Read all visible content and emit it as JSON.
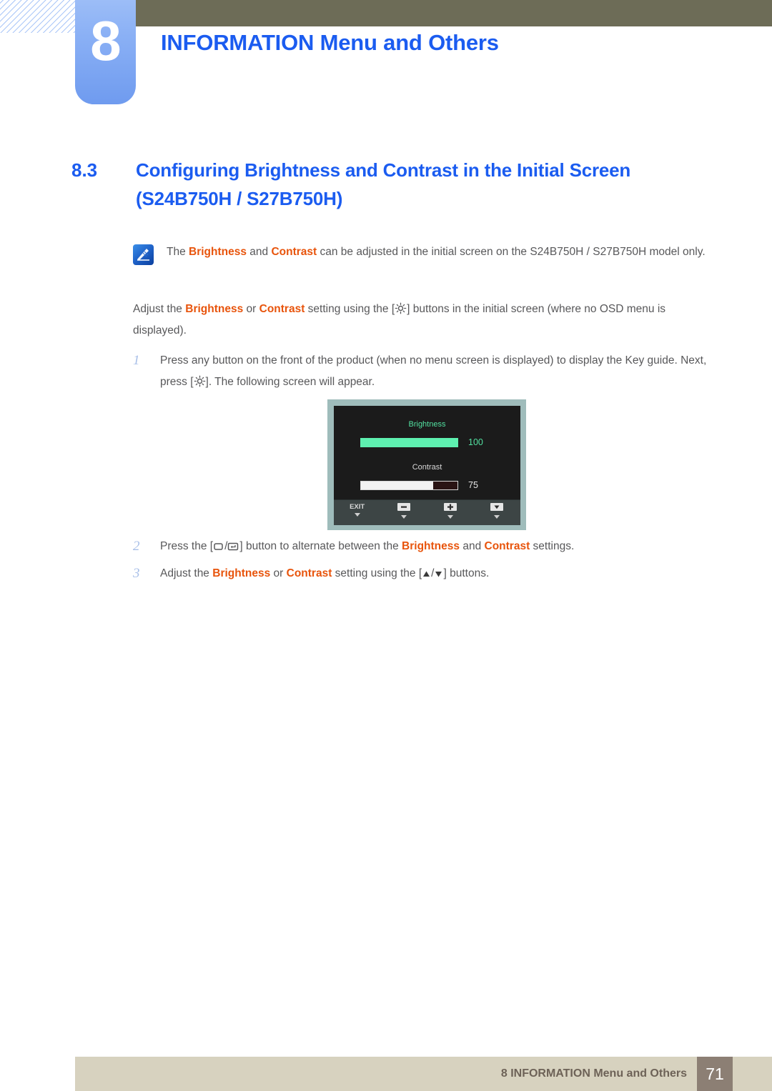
{
  "header": {
    "chapter_number": "8",
    "chapter_title": "INFORMATION Menu and Others",
    "olive_bar_color": "#6d6c57",
    "tab_color": "#8ab0f5",
    "title_color": "#1b5cf0"
  },
  "section": {
    "number": "8.3",
    "title_line1": "Configuring Brightness and Contrast in the Initial Screen",
    "title_line2": "(S24B750H / S27B750H)"
  },
  "note": {
    "icon": "note-pen-icon",
    "text_1": "The ",
    "kw_1": "Brightness",
    "text_2": " and ",
    "kw_2": "Contrast",
    "text_3": " can be adjusted in the initial screen on the S24B750H / S27B750H model only."
  },
  "intro": {
    "text_1": "Adjust the ",
    "kw_1": "Brightness",
    "text_2": " or ",
    "kw_2": "Contrast",
    "text_3": " setting using the [",
    "icon": "brightness-sun-icon",
    "text_4": "] buttons in the initial screen (where no OSD menu is displayed)."
  },
  "steps": [
    {
      "number": "1",
      "text_1": "Press any button on the front of the product (when no menu screen is displayed) to display the Key guide. Next, press [",
      "icon": "brightness-sun-icon",
      "text_2": "]. The following screen will appear."
    },
    {
      "number": "2",
      "text_1": "Press the [",
      "icon_1": "menu-box-icon",
      "separator": "/",
      "icon_2": "enter-box-icon",
      "text_2": "] button to alternate between the ",
      "kw_1": "Brightness",
      "text_3": " and ",
      "kw_2": "Contrast",
      "text_4": " settings."
    },
    {
      "number": "3",
      "text_1": "Adjust the ",
      "kw_1": "Brightness",
      "text_2": " or ",
      "kw_2": "Contrast",
      "text_3": " setting using the [",
      "icon_1": "triangle-up-icon",
      "separator": "/",
      "icon_2": "triangle-down-icon",
      "text_4": "] buttons."
    }
  ],
  "osd": {
    "brightness_label": "Brightness",
    "brightness_value": "100",
    "brightness_percent": 100,
    "brightness_color": "#5ef0b0",
    "contrast_label": "Contrast",
    "contrast_value": "75",
    "contrast_percent": 75,
    "contrast_color": "#f2f2f2",
    "buttons": [
      {
        "label": "EXIT",
        "icon": ""
      },
      {
        "label": "",
        "icon": "minus-icon"
      },
      {
        "label": "",
        "icon": "plus-icon"
      },
      {
        "label": "",
        "icon": "triangle-down-icon"
      }
    ]
  },
  "footer": {
    "text": "8 INFORMATION Menu and Others",
    "page": "71",
    "bar_color": "#d7d2bf",
    "page_box_color": "#8c7f74"
  }
}
